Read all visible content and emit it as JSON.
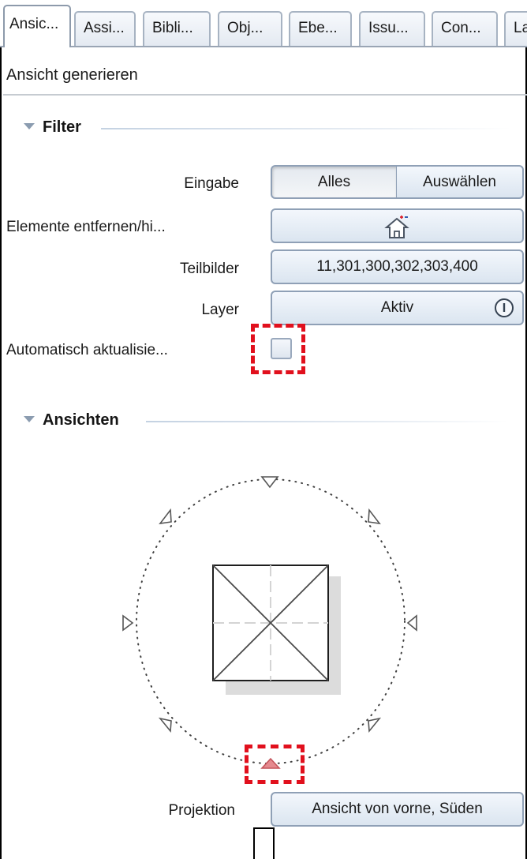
{
  "tabs": [
    {
      "label": "Ansic..."
    },
    {
      "label": "Assi..."
    },
    {
      "label": "Bibli..."
    },
    {
      "label": "Obj..."
    },
    {
      "label": "Ebe..."
    },
    {
      "label": "Issu..."
    },
    {
      "label": "Con..."
    },
    {
      "label": "Lay"
    }
  ],
  "panel_title": "Ansicht generieren",
  "filter": {
    "heading": "Filter",
    "eingabe": {
      "label": "Eingabe",
      "options": [
        "Alles",
        "Auswählen"
      ],
      "selected": "Alles"
    },
    "elemente": {
      "label": "Elemente entfernen/hi...",
      "icon": "house-add-remove-icon"
    },
    "teilbilder": {
      "label": "Teilbilder",
      "value": "11,301,300,302,303,400"
    },
    "layer": {
      "label": "Layer",
      "value": "Aktiv",
      "icon": "info-icon"
    },
    "auto_update": {
      "label": "Automatisch aktualisie...",
      "checked": false
    }
  },
  "ansichten": {
    "heading": "Ansichten",
    "selected_direction": "south",
    "projektion": {
      "label": "Projektion",
      "value": "Ansicht von vorne, Süden"
    }
  },
  "colors": {
    "accent_selected_arrow": "#e58a8f",
    "highlight_dash": "#e1101d",
    "button_border": "#8fa0b6"
  }
}
